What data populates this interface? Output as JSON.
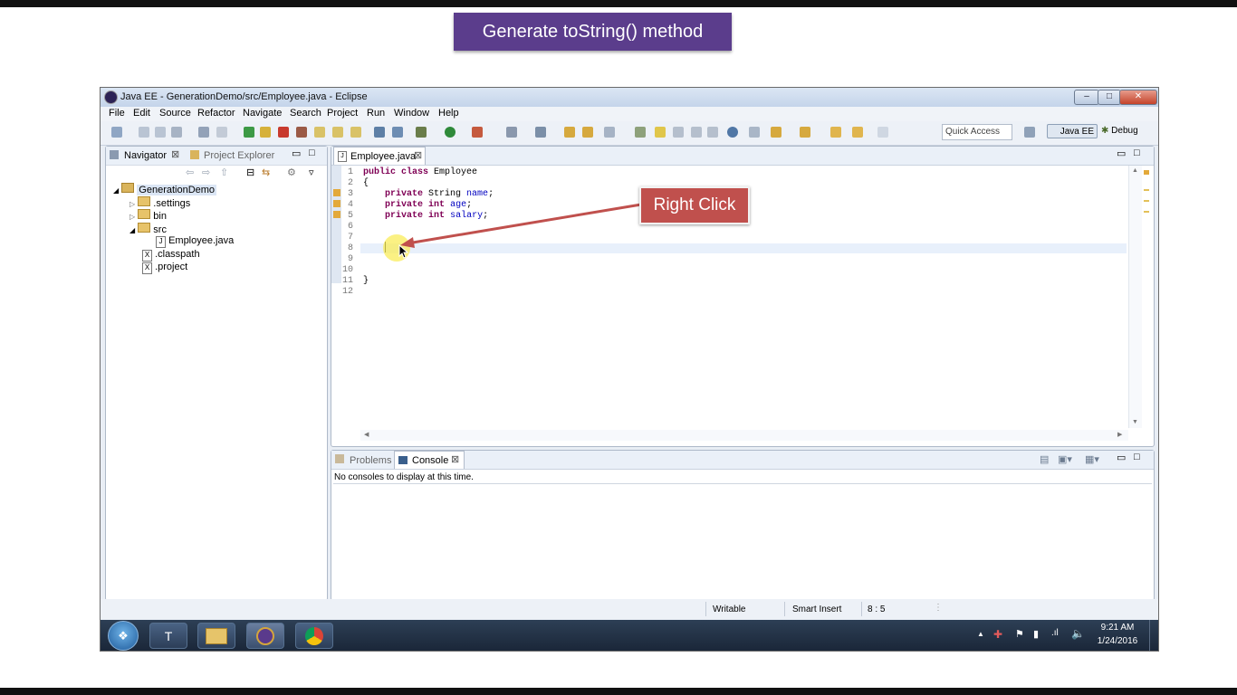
{
  "banner": {
    "title": "Generate toString() method"
  },
  "window": {
    "title": "Java EE - GenerationDemo/src/Employee.java - Eclipse",
    "minimize": "–",
    "maximize": "□",
    "close": "✕"
  },
  "menubar": [
    "File",
    "Edit",
    "Source",
    "Refactor",
    "Navigate",
    "Search",
    "Project",
    "Run",
    "Window",
    "Help"
  ],
  "toolbar": {
    "quick_access": "Quick Access",
    "perspective_javaee": "Java EE",
    "perspective_debug": "Debug"
  },
  "navigator": {
    "tab_navigator": "Navigator",
    "tab_project_explorer": "Project Explorer",
    "tree": {
      "project": "GenerationDemo",
      "settings": ".settings",
      "bin": "bin",
      "src": "src",
      "file": "Employee.java",
      "classpath": ".classpath",
      "projectfile": ".project"
    }
  },
  "editor": {
    "tab": "Employee.java",
    "lines": [
      "public class Employee",
      "{",
      "    private String name;",
      "    private int age;",
      "    private int salary;",
      "",
      "",
      "",
      "",
      "",
      "}",
      ""
    ],
    "line_numbers": [
      "1",
      "2",
      "3",
      "4",
      "5",
      "6",
      "7",
      "8",
      "9",
      "10",
      "11",
      "12"
    ]
  },
  "callout": {
    "label": "Right Click"
  },
  "console": {
    "tab_problems": "Problems",
    "tab_console": "Console",
    "message": "No consoles to display at this time."
  },
  "status": {
    "writable": "Writable",
    "insert": "Smart Insert",
    "position": "8 : 5"
  },
  "taskbar": {
    "time": "9:21 AM",
    "date": "1/24/2016"
  },
  "colors": {
    "banner": "#5b3d8c",
    "callout": "#c0504d",
    "keyword": "#7f0055",
    "field": "#0000c0"
  }
}
